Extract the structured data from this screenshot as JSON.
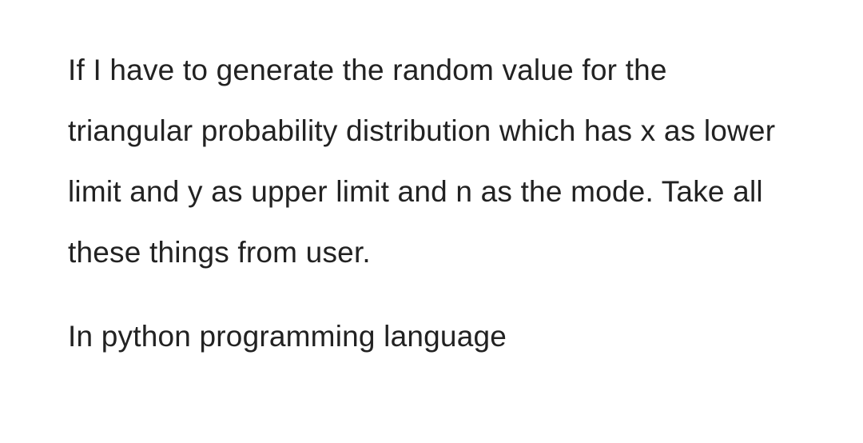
{
  "text": {
    "paragraph1": "If I have to generate the random value for the triangular probability distribution which has x as lower limit and y as upper limit and n as the mode. Take all these things from user.",
    "paragraph2": "In python programming language"
  }
}
